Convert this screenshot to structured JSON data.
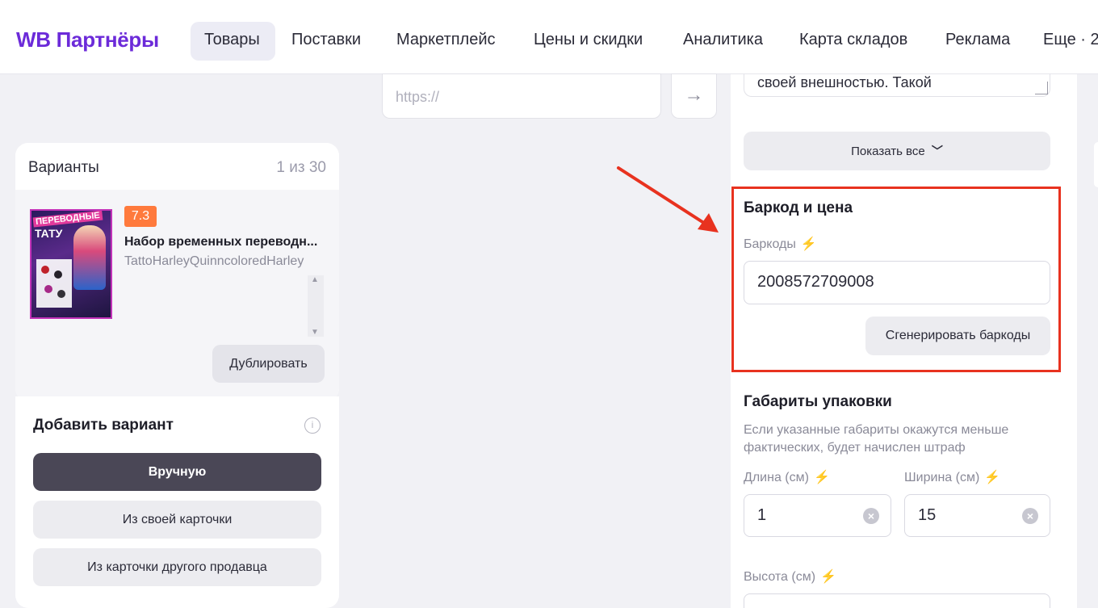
{
  "header": {
    "logo": "WB Партнёры",
    "nav": [
      "Товары",
      "Поставки",
      "Маркетплейс",
      "Цены и скидки",
      "Аналитика",
      "Карта складов",
      "Реклама",
      "Еще · 2"
    ]
  },
  "variants": {
    "title": "Варианты",
    "count": "1 из 30",
    "item": {
      "rating": "7.3",
      "name": "Набор временных переводн...",
      "sku": "TattoHarleyQuinncoloredHarley",
      "image_text_1": "ПЕРЕВОДНЫЕ",
      "image_text_2": "ТАТУ"
    },
    "duplicate_label": "Дублировать"
  },
  "add_variant": {
    "title": "Добавить вариант",
    "info_icon": "i",
    "buttons": [
      "Вручную",
      "Из своей карточки",
      "Из карточки другого продавца"
    ]
  },
  "link_import": {
    "placeholder": "https://",
    "go_icon": "→"
  },
  "description": {
    "visible_text": "своей внешностью. Такой",
    "show_all": "Показать все"
  },
  "barcode_section": {
    "title": "Баркод и цена",
    "barcodes_label": "Баркоды",
    "barcode_value": "2008572709008",
    "generate_label": "Сгенерировать баркоды"
  },
  "package_section": {
    "title": "Габариты упаковки",
    "hint": "Если указанные габариты окажутся меньше фактических, будет начислен штраф",
    "length_label": "Длина (см)",
    "length_value": "1",
    "width_label": "Ширина (см)",
    "width_value": "15",
    "height_label": "Высота (см)"
  },
  "annotation": {
    "highlight_color": "#e8321f"
  },
  "icons": {
    "bolt": "⚡",
    "clear": "×",
    "chevron": "⌄"
  }
}
